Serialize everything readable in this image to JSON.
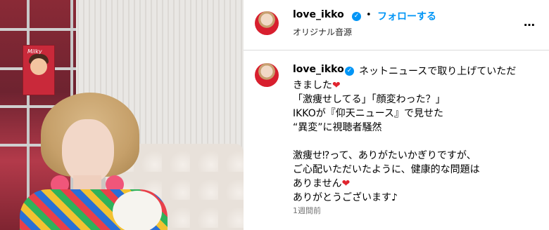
{
  "post": {
    "username": "love_ikko",
    "verified_mark": "✓",
    "separator": "•",
    "follow_label": "フォローする",
    "audio_label": "オリジナル音源",
    "more_label": "…"
  },
  "media": {
    "poster_text": "Milky"
  },
  "caption": {
    "username": "love_ikko",
    "lines": [
      "ネットニュースで取り上げていただ",
      "きました",
      "「激痩せしてる」「顔変わった？」",
      "IKKOが『仰天ニュース』で見せた",
      "“異変”に視聴者騒然",
      "",
      "激痩せ⁉って、ありがたいかぎりですが、",
      "ご心配いただいたように、健康的な問題は",
      "ありません",
      "ありがとうございます♪"
    ],
    "heart": "❤",
    "timestamp": "1週間前"
  },
  "colors": {
    "link": "#0095f6",
    "verified": "#0095f6",
    "heart": "#e0242e",
    "muted": "#737373"
  },
  "icons": {
    "verified": "verified-badge-icon",
    "heart": "heart-emoji-icon",
    "more": "more-options-icon"
  }
}
